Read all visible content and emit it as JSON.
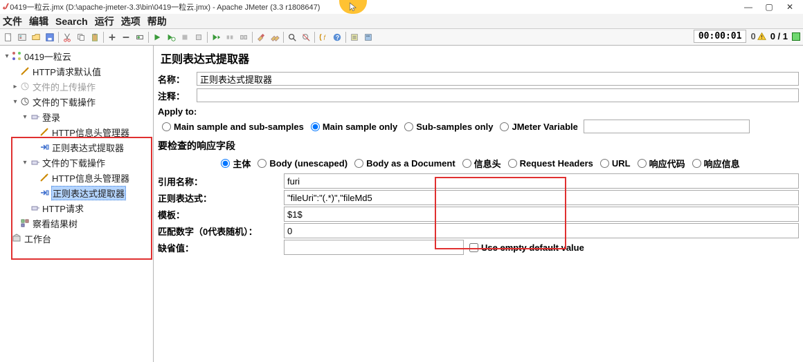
{
  "window": {
    "title": "0419一粒云.jmx (D:\\apache-jmeter-3.3\\bin\\0419一粒云.jmx) - Apache JMeter (3.3 r1808647)",
    "min": "—",
    "max": "▢",
    "close": "✕"
  },
  "menu": {
    "file": "文件",
    "edit": "编辑",
    "search": "Search",
    "run": "运行",
    "options": "选项",
    "help": "帮助"
  },
  "toolbar_status": {
    "time": "00:00:01",
    "errors": "0",
    "threads": "0 / 1"
  },
  "tree": {
    "root": "0419一粒云",
    "n1": "HTTP请求默认值",
    "n2": "文件的上传操作",
    "n3": "文件的下载操作",
    "n3a": "登录",
    "n3a1": "HTTP信息头管理器",
    "n3a2": "正则表达式提取器",
    "n3b": "文件的下载操作",
    "n3b1": "HTTP信息头管理器",
    "n3b2": "正则表达式提取器",
    "n3c": "HTTP请求",
    "n4": "察看结果树",
    "n5": "工作台"
  },
  "panel": {
    "title": "正则表达式提取器",
    "name_label": "名称：",
    "name_value": "正则表达式提取器",
    "comment_label": "注释：",
    "comment_value": "",
    "apply_to_label": "Apply to:",
    "apply_opts": {
      "main_sub": "Main sample and sub-samples",
      "main": "Main sample only",
      "sub": "Sub-samples only",
      "var": "JMeter Variable",
      "var_value": ""
    },
    "field_check_label": "要检查的响应字段",
    "field_opts": {
      "body": "主体",
      "body_unescaped": "Body (unescaped)",
      "body_doc": "Body as a Document",
      "headers": "信息头",
      "req_headers": "Request Headers",
      "url": "URL",
      "code": "响应代码",
      "msg": "响应信息"
    },
    "form": {
      "ref_label": "引用名称：",
      "ref_value": "furi",
      "regex_label": "正则表达式：",
      "regex_value": "\"fileUri\":\"(.*)\",\"fileMd5",
      "template_label": "模板：",
      "template_value": "$1$",
      "match_label": "匹配数字（0代表随机）：",
      "match_value": "0",
      "default_label": "缺省值：",
      "default_value": "",
      "use_empty": "Use empty default value"
    }
  }
}
